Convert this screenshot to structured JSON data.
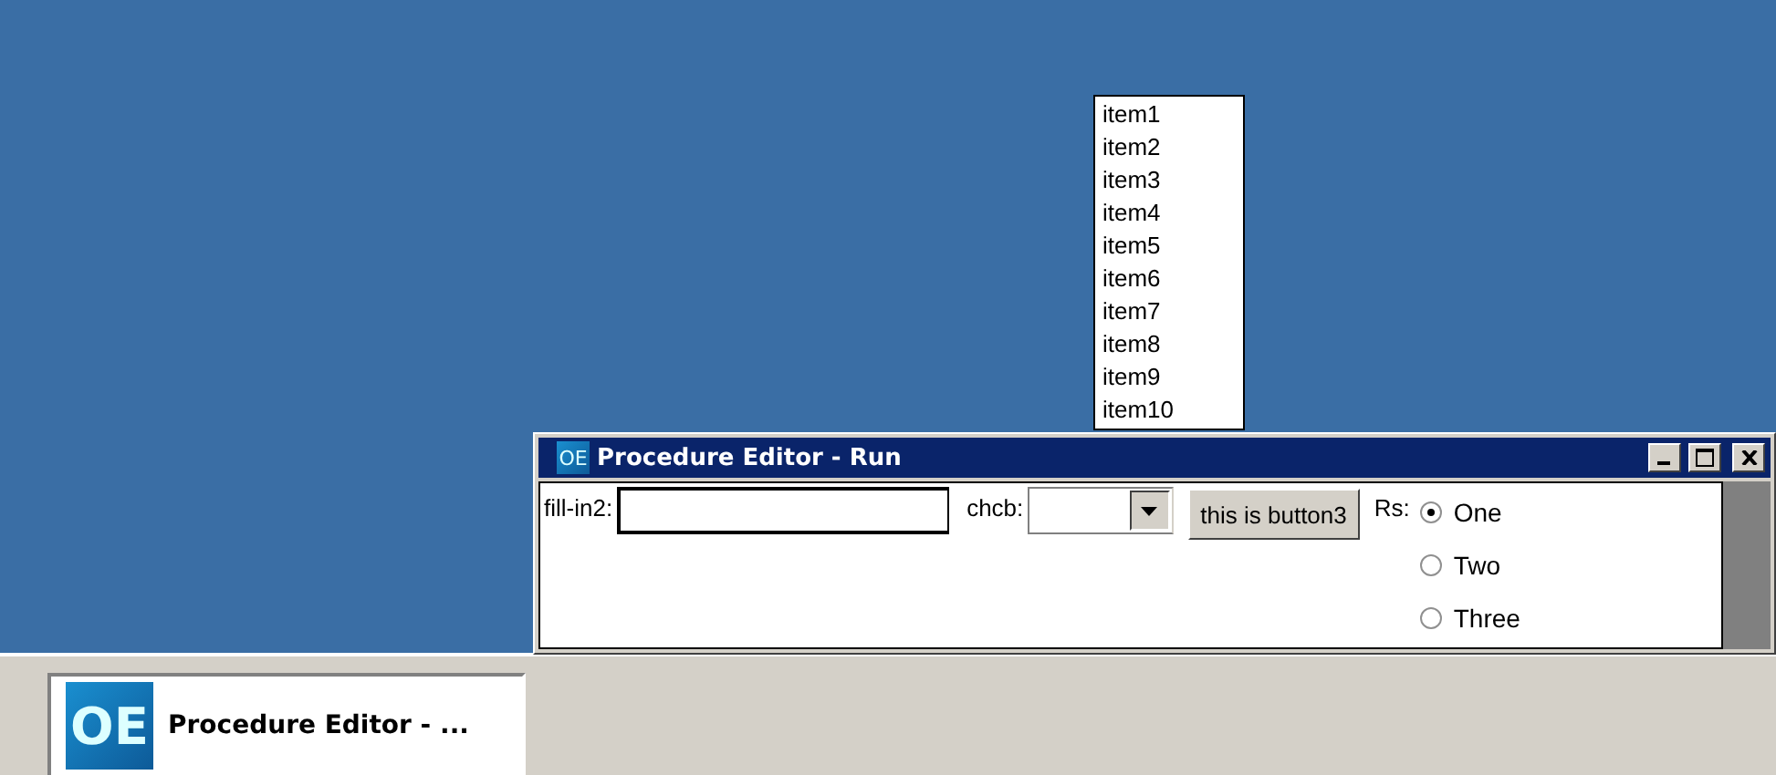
{
  "window": {
    "icon_text": "OE",
    "title": "Procedure Editor - Run",
    "fill_in": {
      "label": "fill-in2:"
    },
    "combo": {
      "label": "chcb:",
      "expanded": true,
      "options": [
        "item1",
        "item2",
        "item3",
        "item4",
        "item5",
        "item6",
        "item7",
        "item8",
        "item9",
        "item10"
      ]
    },
    "button": "this is button3",
    "radio": {
      "label": "Rs:",
      "options": [
        {
          "label": "One",
          "selected": true
        },
        {
          "label": "Two",
          "selected": false
        },
        {
          "label": "Three",
          "selected": false
        }
      ]
    }
  },
  "taskbar": {
    "buttons": [
      {
        "icon_text": "OE",
        "label": "Procedure Editor - ..."
      }
    ]
  }
}
